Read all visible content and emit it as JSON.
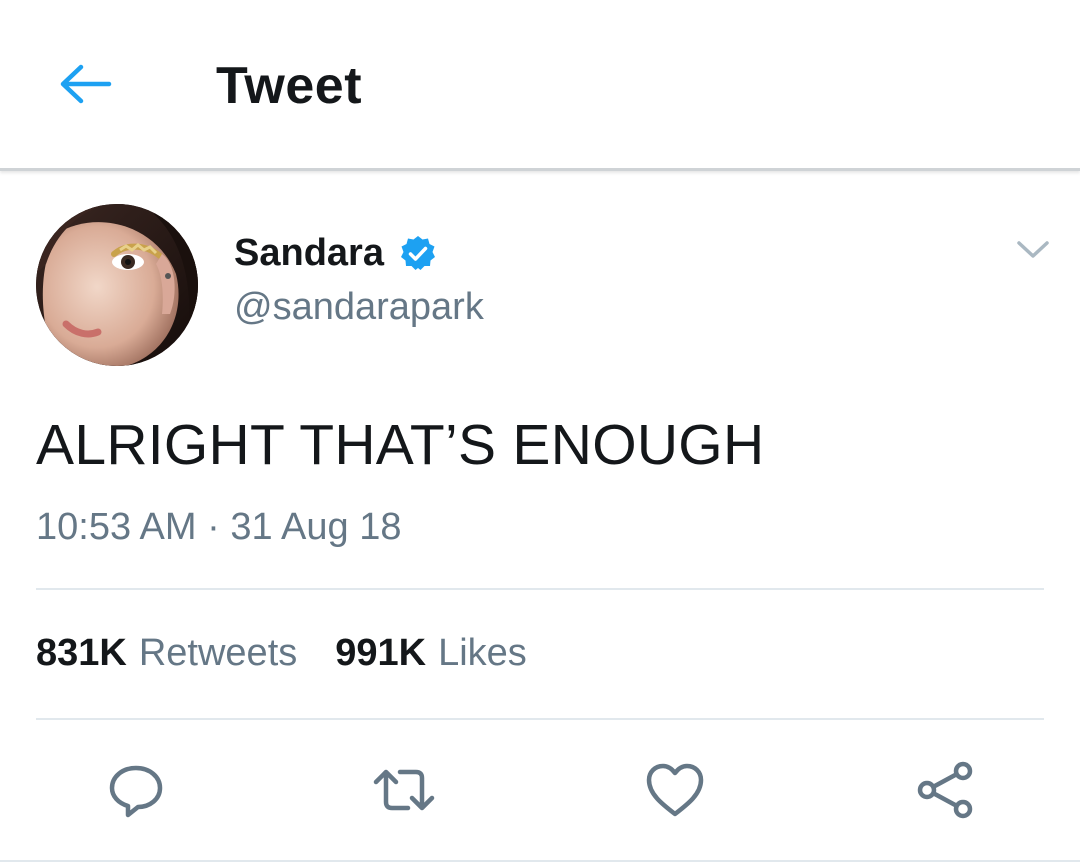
{
  "header": {
    "title": "Tweet",
    "back_icon": "arrow-left-icon",
    "accent_color": "#1da1f2"
  },
  "author": {
    "display_name": "Sandara",
    "handle": "@sandarapark",
    "verified": true,
    "verified_icon": "verified-badge-icon",
    "avatar_icon": "profile-photo"
  },
  "tweet": {
    "text": "ALRIGHT THAT’S ENOUGH",
    "timestamp": "10:53 AM · 31 Aug 18"
  },
  "stats": {
    "retweets_count": "831K",
    "retweets_label": "Retweets",
    "likes_count": "991K",
    "likes_label": "Likes"
  },
  "actions": [
    {
      "name": "reply",
      "icon": "reply-icon"
    },
    {
      "name": "retweet",
      "icon": "retweet-icon"
    },
    {
      "name": "like",
      "icon": "heart-icon"
    },
    {
      "name": "share",
      "icon": "share-icon"
    }
  ],
  "colors": {
    "text_primary": "#14171a",
    "text_secondary": "#657786",
    "divider": "#e1e8ed",
    "verified_blue": "#1da1f2"
  }
}
